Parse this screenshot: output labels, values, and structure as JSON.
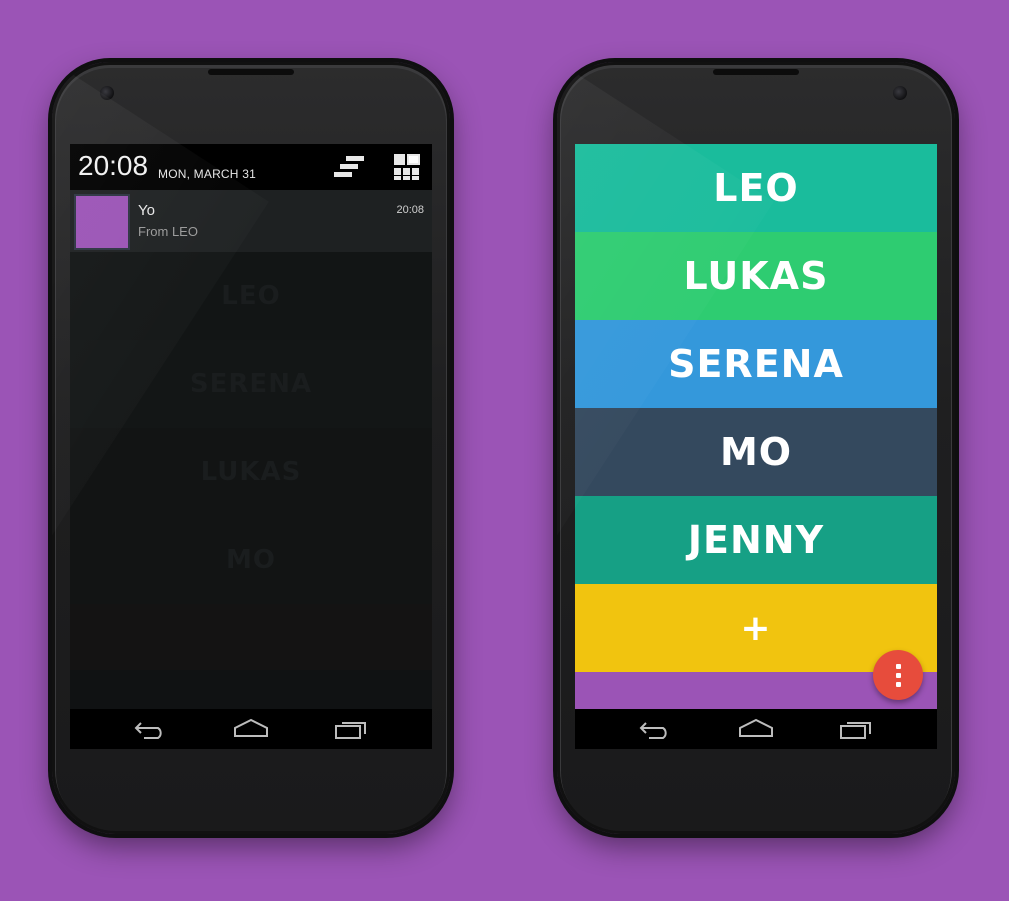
{
  "background_color": "#9b54b6",
  "left_phone": {
    "status_bar": {
      "time": "20:08",
      "date": "MON, MARCH 31",
      "settings_icon": "settings-sliders-icon",
      "quick_settings_icon": "quick-settings-icon"
    },
    "notification": {
      "title": "Yo",
      "subtitle": "From LEO",
      "time": "20:08",
      "thumb_color": "#9b54b6"
    },
    "dimmed_list": [
      "LEO",
      "SERENA",
      "LUKAS",
      "MO",
      ""
    ]
  },
  "right_phone": {
    "friends": [
      {
        "label": "LEO",
        "color": "#1abc9c"
      },
      {
        "label": "LUKAS",
        "color": "#2ecc71"
      },
      {
        "label": "SERENA",
        "color": "#3498db"
      },
      {
        "label": "MO",
        "color": "#34495e"
      },
      {
        "label": "JENNY",
        "color": "#16a085"
      }
    ],
    "add_button": {
      "label": "+",
      "color": "#f1c40f"
    },
    "fab": {
      "icon": "more-vertical-icon",
      "color": "#e74c3c"
    }
  },
  "nav_bar": {
    "back_icon": "back-icon",
    "home_icon": "home-icon",
    "recents_icon": "recents-icon"
  }
}
